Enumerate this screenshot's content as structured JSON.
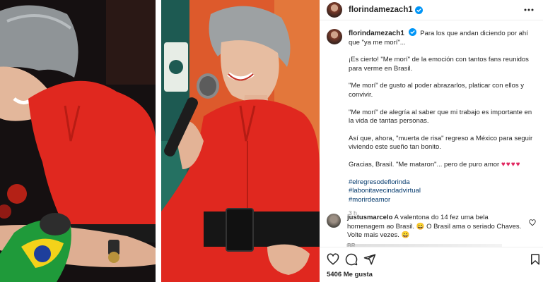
{
  "post": {
    "username": "florindamezach1",
    "caption_intro": "Para los que andan diciendo por ahí que \"ya me morí\"...",
    "paragraphs": [
      "¡Es cierto! \"Me morí\" de la emoción con tantos fans reunidos para verme en Brasil.",
      "\"Me morí\" de gusto al poder abrazarlos, platicar con ellos y convivir.",
      "\"Me morí\" de alegría al saber que mi trabajo es importante en la vida de tantas personas.",
      "Así que, ahora, \"muerta de risa\" regreso a México para seguir viviendo este sueño tan bonito."
    ],
    "closing": "Gracias, Brasil. \"Me mataron\"... pero de puro amor",
    "closing_hearts": "♥♥♥♥",
    "hashtags": [
      "#elregresodeflorinda",
      "#labonitavecindadvirtual",
      "#morirdeamor"
    ],
    "time": "3 h"
  },
  "comment": {
    "username": "justusmarcelo",
    "text": "A valentona do 14 fez uma bela homenagem ao Brasil. 😀 O Brasil ama o seriado Chaves. Volte mais vezes. 😀",
    "meta": "BR"
  },
  "likes_label": "5406 Me gusta",
  "colors": {
    "accent_link": "#00376b",
    "verified": "#0095f6",
    "dress_red": "#e0281f"
  },
  "icons": [
    "more-icon",
    "verified-icon",
    "heart-icon",
    "comment-icon",
    "share-icon",
    "bookmark-icon"
  ]
}
